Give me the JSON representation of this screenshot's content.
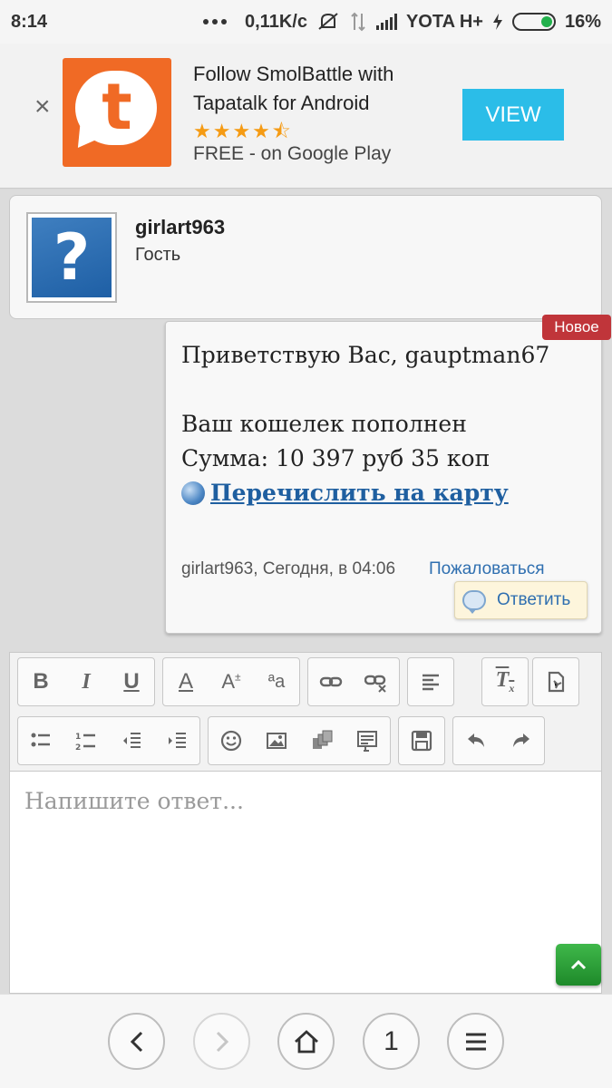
{
  "status_bar": {
    "time": "8:14",
    "speed": "0,11K/c",
    "carrier": "YOTA H+",
    "battery": "16%"
  },
  "ad": {
    "close_icon": "×",
    "title": "Follow SmolBattle with Tapatalk for Android",
    "stars": "★★★★⯪",
    "rating": 4.5,
    "subtitle": "FREE - on Google Play",
    "view_label": "VIEW"
  },
  "user": {
    "name": "girlart963",
    "group": "Гость"
  },
  "post": {
    "badge": "Новое",
    "lines": [
      "Приветствую Вас, gauptman67",
      "",
      "Ваш кошелек пополнен",
      "Сумма: 10 397 руб 35 коп"
    ],
    "link_text": "Перечислить на карту",
    "meta": "girlart963, Сегодня, в 04:06",
    "report_label": "Пожаловаться",
    "reply_label": "Ответить"
  },
  "editor": {
    "placeholder": "Напишите ответ..."
  },
  "nav": {
    "page_number": "1"
  },
  "colors": {
    "ad_accent": "#f06a25",
    "view_button": "#2bbde8",
    "badge": "#c0353a",
    "link": "#1f5fa0",
    "scroll_top": "#1e8a2a"
  }
}
